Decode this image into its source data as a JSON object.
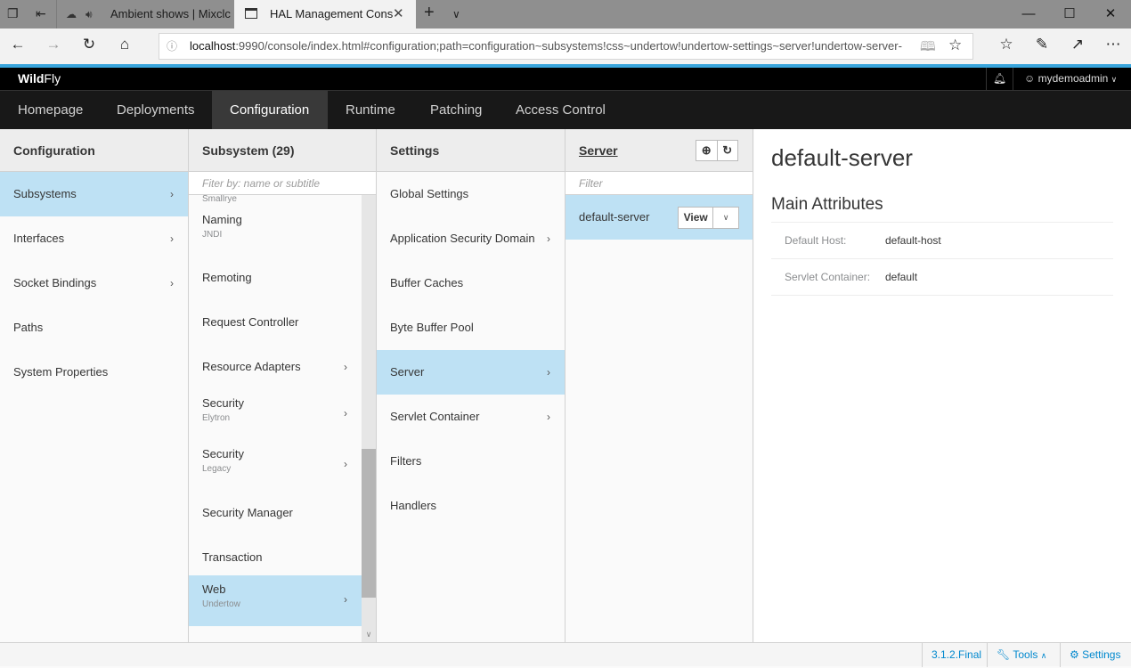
{
  "browser": {
    "inactive_tab": {
      "title": "Ambient shows | Mixclc"
    },
    "active_tab": {
      "title": "HAL Management Cons"
    },
    "url_host": "localhost",
    "url_rest": ":9990/console/index.html#configuration;path=configuration~subsystems!css~undertow!undertow-settings~server!undertow-server-"
  },
  "header": {
    "brand_bold": "Wild",
    "brand_rest": "Fly",
    "user": "mydemoadmin",
    "nav": [
      "Homepage",
      "Deployments",
      "Configuration",
      "Runtime",
      "Patching",
      "Access Control"
    ],
    "active_nav": "Configuration"
  },
  "columns": {
    "configuration": {
      "title": "Configuration",
      "items": [
        {
          "label": "Subsystems",
          "has_next": true,
          "selected": true
        },
        {
          "label": "Interfaces",
          "has_next": true
        },
        {
          "label": "Socket Bindings",
          "has_next": true
        },
        {
          "label": "Paths"
        },
        {
          "label": "System Properties"
        }
      ]
    },
    "subsystem": {
      "title": "Subsystem (29)",
      "filter_placeholder": "Fiter by: name or subtitle",
      "partial_subtitle": "Smallrye",
      "items": [
        {
          "label": "Naming",
          "subtitle": "JNDI"
        },
        {
          "label": "Remoting"
        },
        {
          "label": "Request Controller"
        },
        {
          "label": "Resource Adapters",
          "has_next": true
        },
        {
          "label": "Security",
          "subtitle": "Elytron",
          "has_next": true
        },
        {
          "label": "Security",
          "subtitle": "Legacy",
          "has_next": true
        },
        {
          "label": "Security Manager"
        },
        {
          "label": "Transaction"
        },
        {
          "label": "Web",
          "subtitle": "Undertow",
          "has_next": true,
          "selected": true
        }
      ]
    },
    "settings": {
      "title": "Settings",
      "items": [
        {
          "label": "Global Settings"
        },
        {
          "label": "Application Security Domain",
          "has_next": true
        },
        {
          "label": "Buffer Caches"
        },
        {
          "label": "Byte Buffer Pool"
        },
        {
          "label": "Server",
          "has_next": true,
          "selected": true
        },
        {
          "label": "Servlet Container",
          "has_next": true
        },
        {
          "label": "Filters"
        },
        {
          "label": "Handlers"
        }
      ]
    },
    "server": {
      "title": "Server",
      "filter_placeholder": "Filter",
      "items": [
        {
          "label": "default-server",
          "selected": true,
          "action": "View"
        }
      ]
    }
  },
  "detail": {
    "title": "default-server",
    "section": "Main Attributes",
    "attributes": [
      {
        "label": "Default Host:",
        "value": "default-host"
      },
      {
        "label": "Servlet Container:",
        "value": "default"
      }
    ]
  },
  "footer": {
    "version": "3.1.2.Final",
    "tools": "Tools",
    "settings": "Settings"
  },
  "colors": {
    "accent": "#39a5dc",
    "selected": "#bee1f4",
    "link": "#0088ce"
  }
}
